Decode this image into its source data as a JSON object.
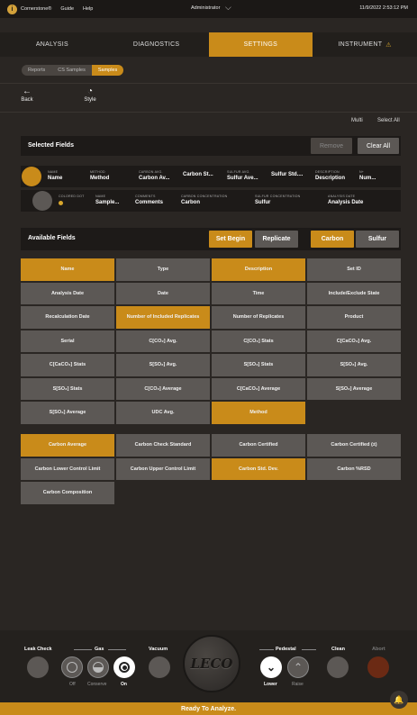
{
  "topbar": {
    "logo_glyph": "i",
    "app_name": "Cornerstone®",
    "links": [
      "Guide",
      "Help"
    ],
    "user": "Administrator",
    "datetime": "11/9/2022 2:53:12 PM"
  },
  "nav": {
    "tabs": [
      "ANALYSIS",
      "DIAGNOSTICS",
      "SETTINGS",
      "INSTRUMENT"
    ],
    "active": "SETTINGS",
    "instrument_warning_glyph": "⚠"
  },
  "breadcrumb": [
    "Reports",
    "CS Samples",
    "Samples"
  ],
  "toolbar": {
    "back_label": "Back",
    "style_label": "Style",
    "multi_label": "Multi",
    "select_all_label": "Select All"
  },
  "selected_fields": {
    "title": "Selected Fields",
    "remove_label": "Remove",
    "clear_all_label": "Clear All",
    "row1": [
      {
        "label": "NAME",
        "value": "Name"
      },
      {
        "label": "METHOD",
        "value": "Method"
      },
      {
        "label": "CARBON AVG.",
        "value": "Carbon Av..."
      },
      {
        "label": "",
        "value": "Carbon St..."
      },
      {
        "label": "SULFUR AVG.",
        "value": "Sulfur Ave..."
      },
      {
        "label": "",
        "value": "Sulfur Std...."
      },
      {
        "label": "DESCRIPTION",
        "value": "Description"
      },
      {
        "label": "N+",
        "value": "Num..."
      }
    ],
    "row2": [
      {
        "label": "COLORED DOT",
        "value": ""
      },
      {
        "label": "NAME",
        "value": "Sample..."
      },
      {
        "label": "COMMENTS",
        "value": "Comments"
      },
      {
        "label": "CARBON CONCENTRATION",
        "value": "Carbon"
      },
      {
        "label": "SULFUR CONCENTRATION",
        "value": "Sulfur"
      },
      {
        "label": "ANALYSIS DATE",
        "value": "Analysis Date"
      }
    ]
  },
  "available_fields": {
    "title": "Available Fields",
    "set_begin_label": "Set Begin",
    "replicate_label": "Replicate",
    "carbon_label": "Carbon",
    "sulfur_label": "Sulfur",
    "grid1": [
      {
        "label": "Name",
        "selected": true
      },
      {
        "label": "Type",
        "selected": false
      },
      {
        "label": "Description",
        "selected": true
      },
      {
        "label": "Set ID",
        "selected": false
      },
      {
        "label": "Analysis Date",
        "selected": false
      },
      {
        "label": "Date",
        "selected": false
      },
      {
        "label": "Time",
        "selected": false
      },
      {
        "label": "Include/Exclude State",
        "selected": false
      },
      {
        "label": "Recalculation Date",
        "selected": false
      },
      {
        "label": "Number of Included Replicates",
        "selected": true
      },
      {
        "label": "Number of Replicates",
        "selected": false
      },
      {
        "label": "Product",
        "selected": false
      },
      {
        "label": "Serial",
        "selected": false
      },
      {
        "label": "C[CO₂] Avg.",
        "selected": false
      },
      {
        "label": "C[CO₂] Stats",
        "selected": false
      },
      {
        "label": "C[CaCO₃] Avg.",
        "selected": false
      },
      {
        "label": "C[CaCO₃] Stats",
        "selected": false
      },
      {
        "label": "S[SO₂] Avg.",
        "selected": false
      },
      {
        "label": "S[SO₂] Stats",
        "selected": false
      },
      {
        "label": "S[SO₃] Avg.",
        "selected": false
      },
      {
        "label": "S[SO₃] Stats",
        "selected": false
      },
      {
        "label": "C[CO₂] Average",
        "selected": false
      },
      {
        "label": "C[CaCO₃] Average",
        "selected": false
      },
      {
        "label": "S[SO₂] Average",
        "selected": false
      },
      {
        "label": "S[SO₃] Average",
        "selected": false
      },
      {
        "label": "UDC Avg.",
        "selected": false
      },
      {
        "label": "Method",
        "selected": true
      }
    ],
    "grid2": [
      {
        "label": "Carbon Average",
        "selected": true
      },
      {
        "label": "Carbon Check Standard",
        "selected": false
      },
      {
        "label": "Carbon Certified",
        "selected": false
      },
      {
        "label": "Carbon Certified (±)",
        "selected": false
      },
      {
        "label": "Carbon Lower Control Limit",
        "selected": false
      },
      {
        "label": "Carbon Upper Control Limit",
        "selected": false
      },
      {
        "label": "Carbon Std. Dev.",
        "selected": true
      },
      {
        "label": "Carbon %RSD",
        "selected": false
      },
      {
        "label": "Carbon Composition",
        "selected": false
      }
    ]
  },
  "bottom": {
    "leak_check": "Leak Check",
    "gas": "Gas",
    "gas_off": "Off",
    "gas_conserve": "Conserve",
    "gas_on": "On",
    "vacuum": "Vacuum",
    "logo": "LECO",
    "pedestal": "Pedestal",
    "lower": "Lower",
    "raise": "Raise",
    "clean": "Clean",
    "abort": "Abort",
    "lower_glyph": "⌄",
    "raise_glyph": "⌃"
  },
  "status": {
    "text": "Ready To Analyze.",
    "bell_glyph": "🔔"
  },
  "colors": {
    "accent": "#c98b1a",
    "cell": "#5c5855",
    "background": "#2a2623"
  }
}
